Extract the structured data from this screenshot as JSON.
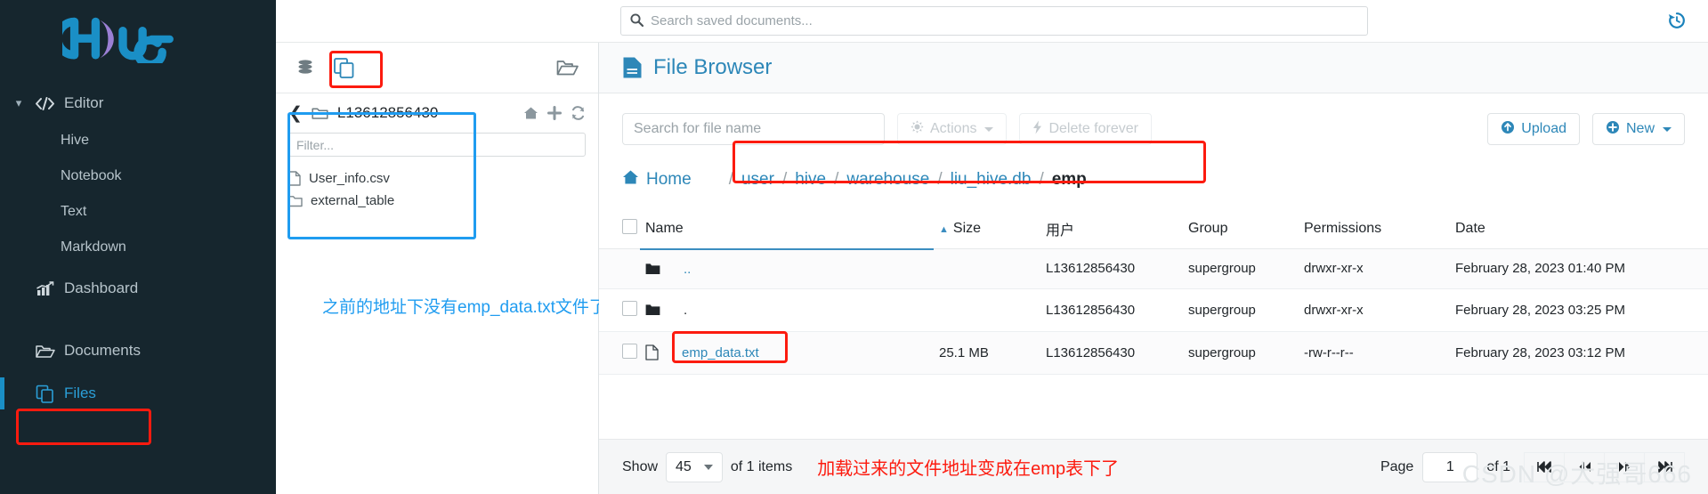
{
  "brand": {
    "logo_text": "hue",
    "accent": "#1a8fc6",
    "logo_purple": "#9b7fd4"
  },
  "topbar": {
    "search_placeholder": "Search saved documents...",
    "search_value": "",
    "search_icon": "search-icon",
    "history_icon": "history-icon"
  },
  "sidebar": {
    "editor": {
      "label": "Editor",
      "icon": "code-icon",
      "chevron": "chevron-down-icon"
    },
    "editor_children": [
      {
        "label": "Hive"
      },
      {
        "label": "Notebook"
      },
      {
        "label": "Text"
      },
      {
        "label": "Markdown"
      }
    ],
    "items": [
      {
        "label": "Dashboard",
        "icon": "chart-icon",
        "active": false
      },
      {
        "label": "Documents",
        "icon": "folder-open-icon",
        "active": false
      },
      {
        "label": "Files",
        "icon": "files-icon",
        "active": true
      }
    ]
  },
  "assist": {
    "tabs": [
      {
        "name": "database-tab",
        "icon": "database-icon",
        "selected": false
      },
      {
        "name": "files-tab",
        "icon": "files-icon",
        "selected": true
      },
      {
        "name": "documents-tab",
        "icon": "folder-open-icon",
        "selected": false
      }
    ],
    "tree": {
      "back_icon": "chevron-left-icon",
      "folder_icon": "folder-icon",
      "current_folder": "L13612856430",
      "actions": [
        {
          "name": "home-icon",
          "glyph": "home"
        },
        {
          "name": "plus-icon",
          "glyph": "plus"
        },
        {
          "name": "refresh-icon",
          "glyph": "refresh"
        }
      ],
      "filter_placeholder": "Filter...",
      "filter_value": "",
      "entries": [
        {
          "name": "User_info.csv",
          "icon": "file-icon",
          "type": "file"
        },
        {
          "name": "external_table",
          "icon": "folder-icon",
          "type": "folder"
        }
      ]
    },
    "annotation": "之前的地址下没有emp_data.txt文件了"
  },
  "main": {
    "title": "File Browser",
    "title_icon": "document-icon",
    "toolbar": {
      "search_placeholder": "Search for file name",
      "search_value": "",
      "actions_label": "Actions",
      "actions_icon": "gear-icon",
      "delete_label": "Delete forever",
      "delete_icon": "bolt-icon",
      "upload_label": "Upload",
      "upload_icon": "upload-circle-icon",
      "new_label": "New",
      "new_icon": "plus-circle-icon"
    },
    "breadcrumb": {
      "home_label": "Home",
      "home_icon": "home-icon",
      "separator": "/",
      "parts": [
        {
          "label": "user",
          "current": false
        },
        {
          "label": "hive",
          "current": false
        },
        {
          "label": "warehouse",
          "current": false
        },
        {
          "label": "liu_hive.db",
          "current": false
        },
        {
          "label": "emp",
          "current": true
        }
      ]
    },
    "table": {
      "columns": [
        "Name",
        "Size",
        "用户",
        "Group",
        "Permissions",
        "Date"
      ],
      "sorted_column": "Name",
      "sort_icon": "sort-asc-icon",
      "rows": [
        {
          "select": false,
          "show_checkbox": false,
          "icon": "folder-icon",
          "name": "..",
          "name_is_link": true,
          "size": "",
          "user": "L13612856430",
          "group": "supergroup",
          "permissions": "drwxr-xr-x",
          "date": "February 28, 2023 01:40 PM"
        },
        {
          "select": false,
          "show_checkbox": true,
          "icon": "folder-icon",
          "name": ".",
          "name_is_link": false,
          "size": "",
          "user": "L13612856430",
          "group": "supergroup",
          "permissions": "drwxr-xr-x",
          "date": "February 28, 2023 03:25 PM"
        },
        {
          "select": false,
          "show_checkbox": true,
          "icon": "file-icon",
          "name": "emp_data.txt",
          "name_is_link": true,
          "size": "25.1 MB",
          "user": "L13612856430",
          "group": "supergroup",
          "permissions": "-rw-r--r--",
          "date": "February 28, 2023 03:12 PM"
        }
      ]
    },
    "footer": {
      "show_label": "Show",
      "page_size": "45",
      "of_items_label": "of 1 items",
      "annotation": "加载过来的文件地址变成在emp表下了",
      "page_label": "Page",
      "page_value": "1",
      "of_pages_label": "of 1",
      "buttons": [
        {
          "name": "first-page-button",
          "glyph": "⏮"
        },
        {
          "name": "prev-page-button",
          "glyph": "⏪"
        },
        {
          "name": "next-page-button",
          "glyph": "⏩"
        },
        {
          "name": "last-page-button",
          "glyph": "⏭"
        }
      ]
    }
  },
  "watermark": "CSDN @大强哥666"
}
